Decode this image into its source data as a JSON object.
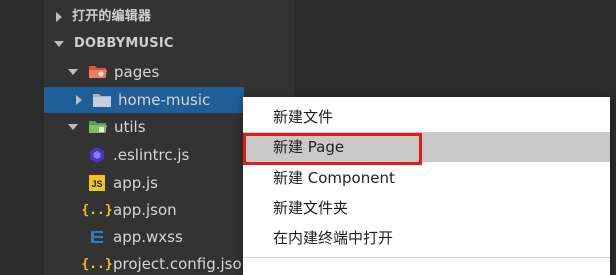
{
  "explorer": {
    "open_editors_label": "打开的编辑器",
    "project_label": "DOBBYMUSIC",
    "items": [
      {
        "label": "pages",
        "type": "folder-open"
      },
      {
        "label": "home-music",
        "type": "folder-closed"
      },
      {
        "label": "utils",
        "type": "folder-open"
      },
      {
        "label": ".eslintrc.js",
        "type": "eslint"
      },
      {
        "label": "app.js",
        "type": "js"
      },
      {
        "label": "app.json",
        "type": "json"
      },
      {
        "label": "app.wxss",
        "type": "css"
      },
      {
        "label": "project.config.json",
        "type": "json"
      }
    ],
    "js_badge": "JS",
    "json_badge": "{..}"
  },
  "context_menu": {
    "items": [
      {
        "label": "新建文件"
      },
      {
        "label": "新建 Page"
      },
      {
        "label": "新建 Component"
      },
      {
        "label": "新建文件夹"
      },
      {
        "label": "在内建终端中打开"
      }
    ],
    "hovered_index": 1
  },
  "colors": {
    "selection": "#1f5e99",
    "highlight_border": "#e11b1b",
    "folder_red": "#e5533d",
    "folder_green": "#6aa84f",
    "js_yellow": "#f0c419",
    "css_blue": "#2f7ec1"
  }
}
